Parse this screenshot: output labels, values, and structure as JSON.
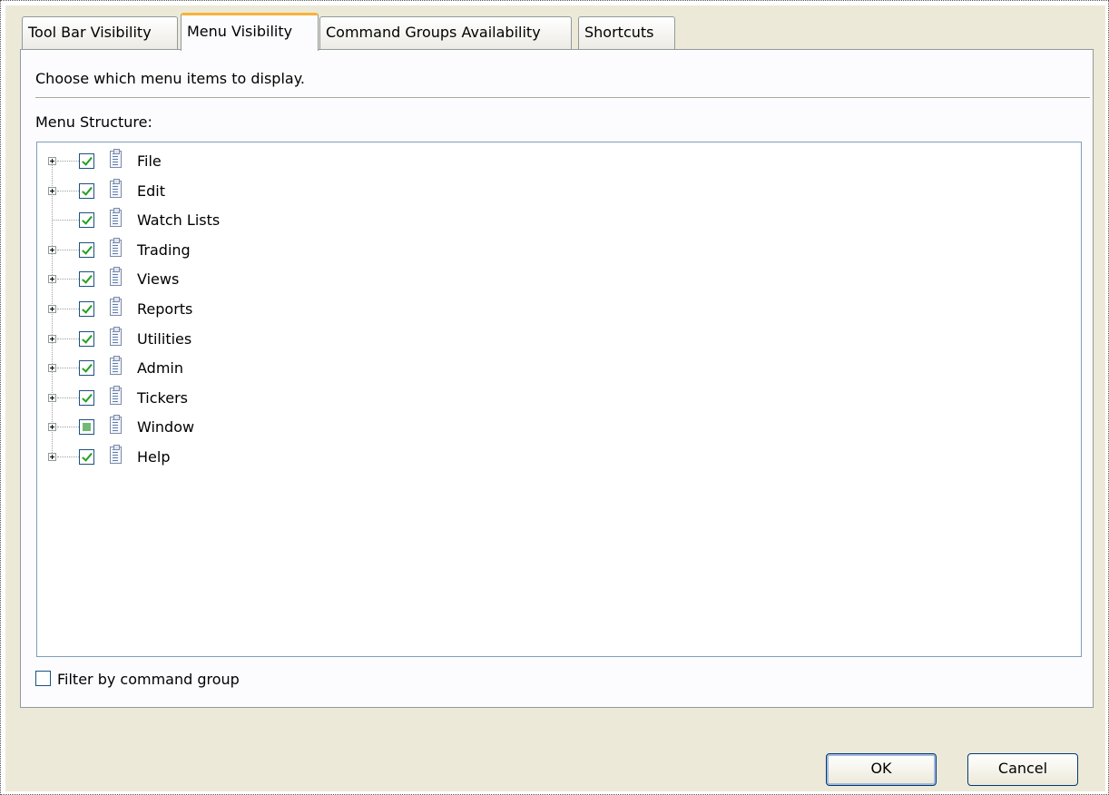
{
  "tabs": [
    {
      "label": "Tool Bar Visibility"
    },
    {
      "label": "Menu Visibility"
    },
    {
      "label": "Command Groups Availability"
    },
    {
      "label": "Shortcuts"
    }
  ],
  "panel": {
    "description": "Choose which menu items to display.",
    "structure_label": "Menu Structure:"
  },
  "tree": {
    "items": [
      {
        "label": "File",
        "checked": "checked",
        "expandable": true
      },
      {
        "label": "Edit",
        "checked": "checked",
        "expandable": true
      },
      {
        "label": "Watch Lists",
        "checked": "checked",
        "expandable": false
      },
      {
        "label": "Trading",
        "checked": "checked",
        "expandable": true
      },
      {
        "label": "Views",
        "checked": "checked",
        "expandable": true
      },
      {
        "label": "Reports",
        "checked": "checked",
        "expandable": true
      },
      {
        "label": "Utilities",
        "checked": "checked",
        "expandable": true
      },
      {
        "label": "Admin",
        "checked": "checked",
        "expandable": true
      },
      {
        "label": "Tickers",
        "checked": "checked",
        "expandable": true
      },
      {
        "label": "Window",
        "checked": "partial",
        "expandable": true
      },
      {
        "label": "Help",
        "checked": "checked",
        "expandable": true
      }
    ]
  },
  "filter": {
    "label": "Filter by command group",
    "checked": false
  },
  "buttons": {
    "ok": "OK",
    "cancel": "Cancel"
  }
}
